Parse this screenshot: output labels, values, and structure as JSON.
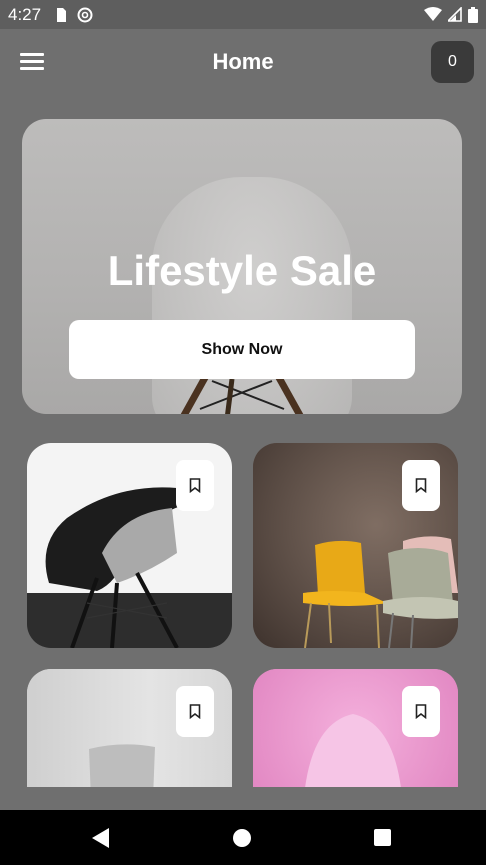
{
  "status_bar": {
    "time": "4:27",
    "icons": [
      "sd-card-icon",
      "do-not-disturb-icon",
      "wifi-icon",
      "signal-icon",
      "battery-icon"
    ]
  },
  "app_bar": {
    "title": "Home",
    "cart_count": "0",
    "menu_icon": "hamburger-menu-icon"
  },
  "hero": {
    "title": "Lifestyle Sale",
    "button_label": "Show Now"
  },
  "products": [
    {
      "name": "black-eames-chair",
      "icon": "bookmark-icon"
    },
    {
      "name": "yellow-and-sage-chairs",
      "icon": "bookmark-icon"
    },
    {
      "name": "white-chair",
      "icon": "bookmark-icon"
    },
    {
      "name": "pink-chair",
      "icon": "bookmark-icon"
    }
  ],
  "nav_bar": {
    "icons": [
      "back-icon",
      "home-icon",
      "recents-icon"
    ]
  }
}
